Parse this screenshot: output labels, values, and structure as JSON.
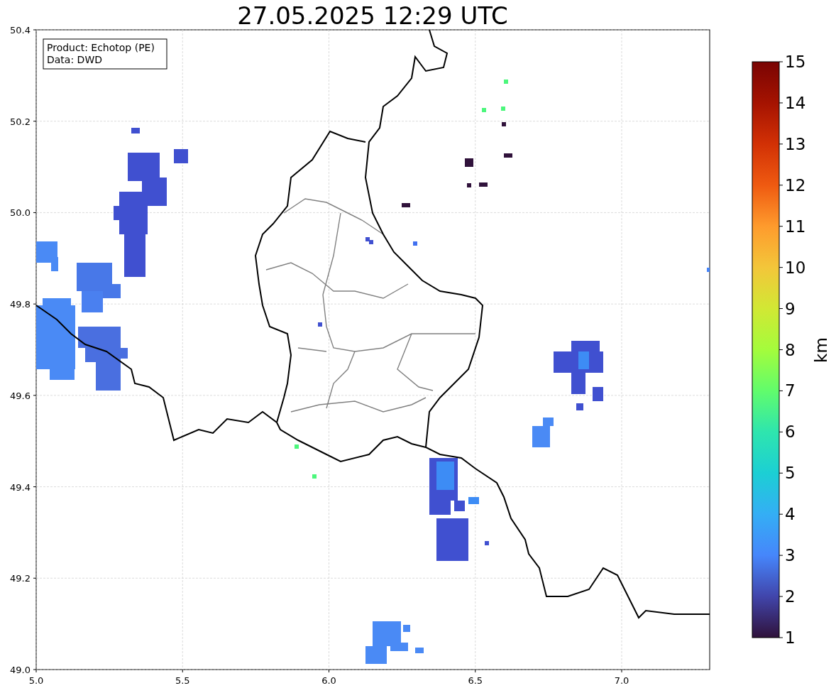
{
  "title": "27.05.2025 12:29 UTC",
  "legend": [
    "Product: Echotop (PE)",
    "Data: DWD"
  ],
  "map": {
    "xticks": [
      "5.0",
      "5.5",
      "6.0",
      "6.5",
      "7.0"
    ],
    "yticks": [
      "50.4",
      "50.2",
      "50.0",
      "49.8",
      "49.6",
      "49.4",
      "49.2",
      "49.0"
    ]
  },
  "colorbar": {
    "label": "km",
    "ticks": [
      "15",
      "14",
      "13",
      "12",
      "11",
      "10",
      "9",
      "8",
      "7",
      "6",
      "5",
      "4",
      "3",
      "2",
      "1"
    ]
  }
}
